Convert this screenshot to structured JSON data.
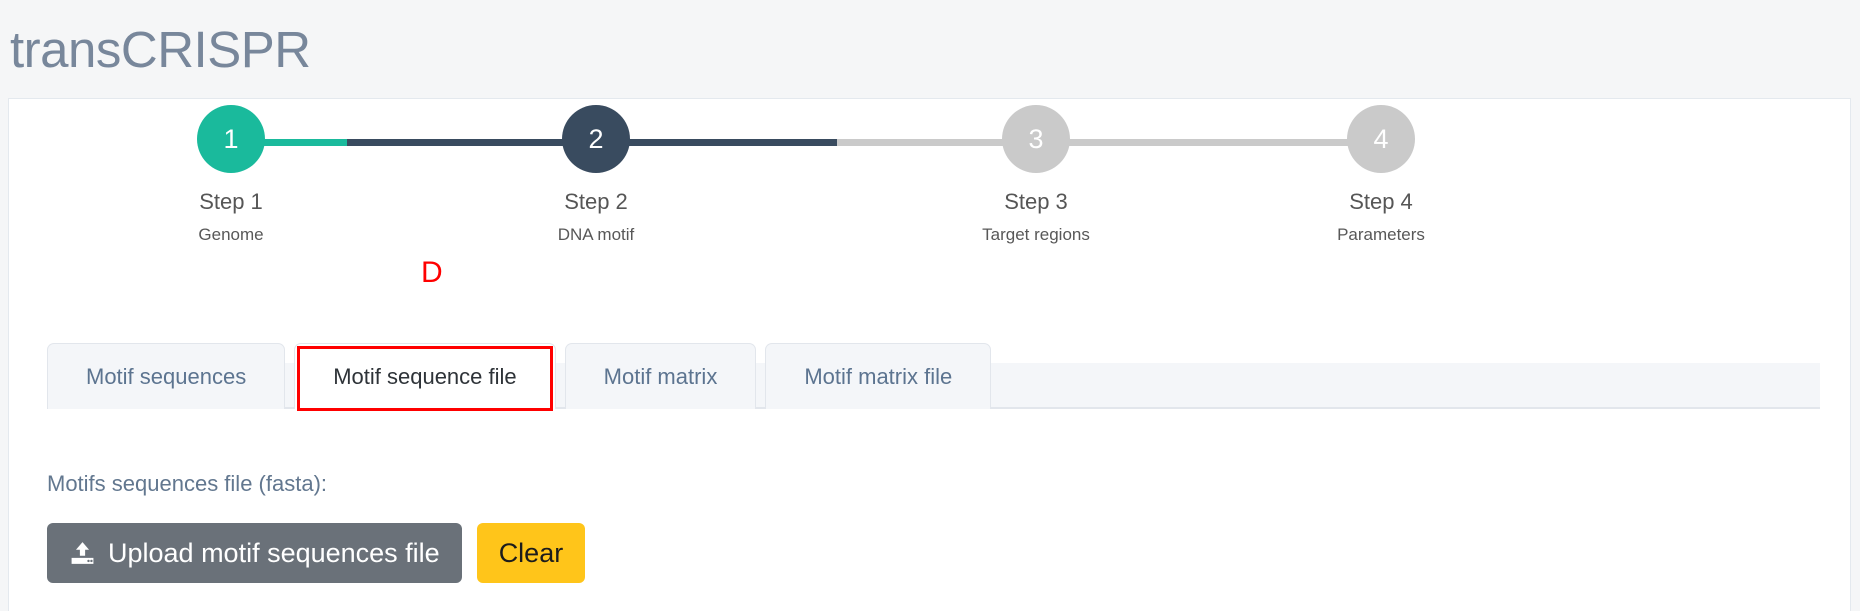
{
  "header": {
    "app_title": "transCRISPR",
    "title_color": "#78879b"
  },
  "stepper": {
    "steps": [
      {
        "number": "1",
        "label": "Step 1",
        "sublabel": "Genome",
        "state": "complete",
        "color": "#1aba9c"
      },
      {
        "number": "2",
        "label": "Step 2",
        "sublabel": "DNA motif",
        "state": "current",
        "color": "#394b5f"
      },
      {
        "number": "3",
        "label": "Step 3",
        "sublabel": "Target regions",
        "state": "upcoming",
        "color": "#cacaca"
      },
      {
        "number": "4",
        "label": "Step 4",
        "sublabel": "Parameters",
        "state": "upcoming",
        "color": "#cacaca"
      }
    ],
    "connector_colors": {
      "complete": "#1aba9c",
      "current": "#394b5f",
      "upcoming": "#cacaca"
    }
  },
  "annotations": [
    {
      "letter": "D",
      "color": "#ff0000",
      "target": "tab-motif-sequence-file"
    }
  ],
  "tabs": {
    "items": [
      {
        "label": "Motif sequences",
        "active": false
      },
      {
        "label": "Motif sequence file",
        "active": true
      },
      {
        "label": "Motif matrix",
        "active": false
      },
      {
        "label": "Motif matrix file",
        "active": false
      }
    ],
    "highlight_color": "#ff0000"
  },
  "panel": {
    "field_label": "Motifs sequences file (fasta):",
    "upload_button": {
      "label": "Upload motif sequences file",
      "icon": "upload-icon",
      "color": "#6a7179"
    },
    "clear_button": {
      "label": "Clear",
      "color": "#ffc51a"
    }
  }
}
